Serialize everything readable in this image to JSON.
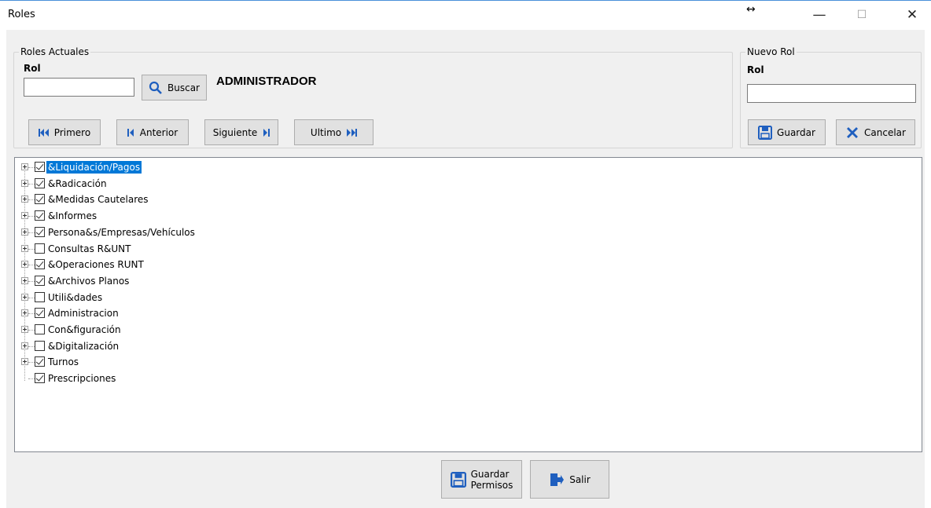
{
  "window": {
    "title": "Roles",
    "resize_glyph": "↔",
    "minimize_glyph": "—",
    "maximize_glyph": "☐",
    "close_glyph": "✕"
  },
  "current_roles": {
    "legend": "Roles Actuales",
    "rol_label": "Rol",
    "rol_value": "",
    "search_label": "Buscar",
    "role_name": "ADMINISTRADOR",
    "nav": {
      "first": "Primero",
      "previous": "Anterior",
      "next": "Siguiente",
      "last": "Ultimo"
    }
  },
  "new_role": {
    "legend": "Nuevo Rol",
    "rol_label": "Rol",
    "rol_value": "",
    "save_label": "Guardar",
    "cancel_label": "Cancelar"
  },
  "tree": {
    "items": [
      {
        "label": "&Liquidación/Pagos",
        "checked": true,
        "selected": true,
        "expandable": true
      },
      {
        "label": "&Radicación",
        "checked": true,
        "selected": false,
        "expandable": true
      },
      {
        "label": "&Medidas Cautelares",
        "checked": true,
        "selected": false,
        "expandable": true
      },
      {
        "label": "&Informes",
        "checked": true,
        "selected": false,
        "expandable": true
      },
      {
        "label": "Persona&s/Empresas/Vehículos",
        "checked": true,
        "selected": false,
        "expandable": true
      },
      {
        "label": "Consultas R&UNT",
        "checked": false,
        "selected": false,
        "expandable": true
      },
      {
        "label": "&Operaciones RUNT",
        "checked": true,
        "selected": false,
        "expandable": true
      },
      {
        "label": "&Archivos Planos",
        "checked": true,
        "selected": false,
        "expandable": true
      },
      {
        "label": "Utili&dades",
        "checked": false,
        "selected": false,
        "expandable": true
      },
      {
        "label": "Administracion",
        "checked": true,
        "selected": false,
        "expandable": true
      },
      {
        "label": "Con&figuración",
        "checked": false,
        "selected": false,
        "expandable": true
      },
      {
        "label": "&Digitalización",
        "checked": false,
        "selected": false,
        "expandable": true
      },
      {
        "label": "Turnos",
        "checked": true,
        "selected": false,
        "expandable": true
      },
      {
        "label": "Prescripciones",
        "checked": true,
        "selected": false,
        "expandable": false
      }
    ]
  },
  "footer": {
    "save_permissions_line1": "Guardar",
    "save_permissions_line2": "Permisos",
    "exit_label": "Salir"
  }
}
